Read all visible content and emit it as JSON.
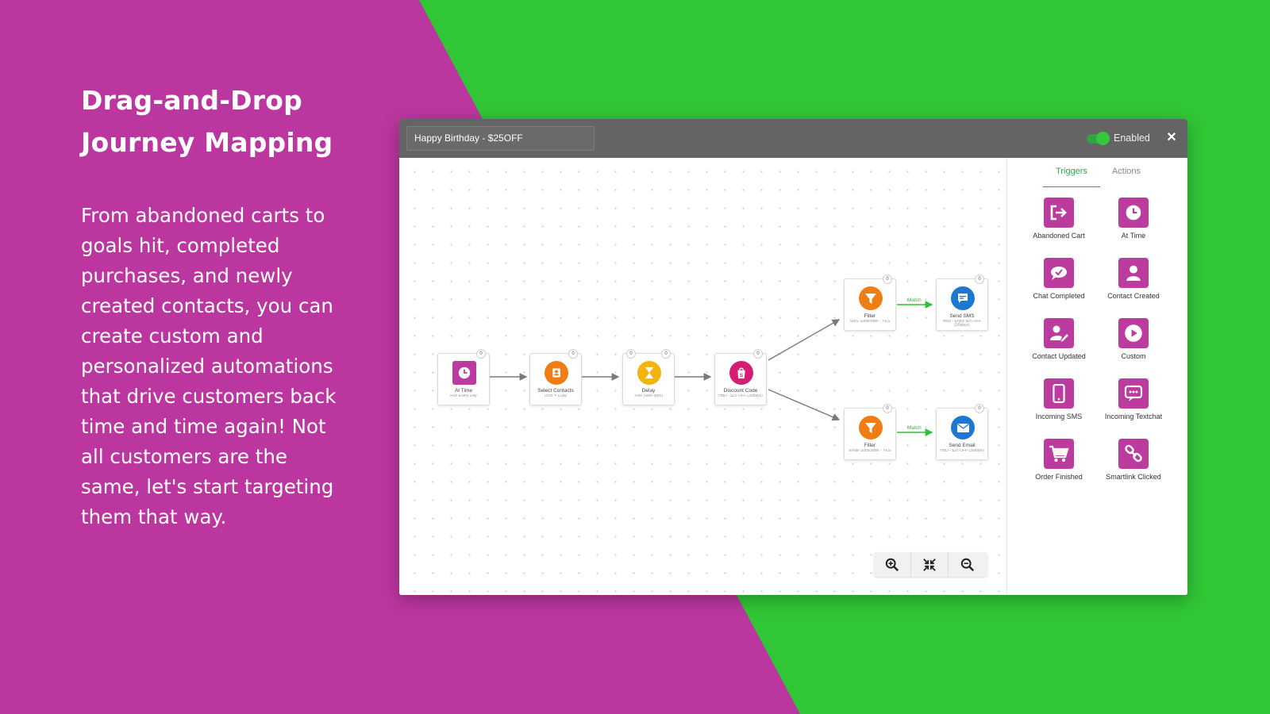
{
  "colors": {
    "magenta_bg": "#bb369f",
    "green_bg": "#30c636",
    "trigger_icon": "#bb3b9f",
    "accent_green": "#2faa47",
    "orange": "#ef7d13",
    "yellow": "#f2b30c",
    "pink": "#d61d73",
    "blue": "#1e78d1"
  },
  "hero": {
    "title_line1": "Drag-and-Drop",
    "title_line2": "Journey Mapping",
    "body": "From abandoned carts to goals hit, completed purchases, and newly created contacts, you can create custom and personalized automations that drive customers back time and time again! Not all customers are the same, let's start targeting them that way."
  },
  "window": {
    "journey_name": "Happy Birthday - $25OFF",
    "status_label": "Enabled",
    "status_enabled": true,
    "close_icon": "close-icon"
  },
  "flow": {
    "nodes": [
      {
        "title": "At Time",
        "subtitle": "Run Every Day",
        "count": "0",
        "icon": "clock-icon"
      },
      {
        "title": "Select Contacts",
        "subtitle": "DOB = 1Day",
        "count": "0",
        "icon": "contacts-icon"
      },
      {
        "title": "Delay",
        "subtitle": "+9hr (9am-9pm)",
        "count": "0",
        "icon": "hourglass-icon"
      },
      {
        "title": "Discount Code",
        "subtitle": "HBD - $25 OFF (30days)",
        "count": "0",
        "icon": "shopify-icon"
      },
      {
        "title": "Filter",
        "subtitle": "SMS Subscriber - YES",
        "count": "0",
        "icon": "filter-icon"
      },
      {
        "title": "Send SMS",
        "subtitle": "HBD - Enjoy $25 OFF (30days)",
        "count": "0",
        "icon": "sms-icon"
      },
      {
        "title": "Filter",
        "subtitle": "Email Subscriber - YES",
        "count": "0",
        "icon": "filter-icon"
      },
      {
        "title": "Send Email",
        "subtitle": "HBD - $25 OFF (30days)",
        "count": "0",
        "icon": "email-icon"
      }
    ],
    "match_label_1": "Match",
    "match_label_2": "Match"
  },
  "panel": {
    "tabs": [
      "Triggers",
      "Actions"
    ],
    "active_tab": "Triggers",
    "triggers": [
      {
        "label": "Abandoned Cart",
        "icon": "exit-icon"
      },
      {
        "label": "At Time",
        "icon": "clock-icon"
      },
      {
        "label": "Chat Completed",
        "icon": "chat-check-icon"
      },
      {
        "label": "Contact Created",
        "icon": "person-icon"
      },
      {
        "label": "Contact Updated",
        "icon": "person-edit-icon"
      },
      {
        "label": "Custom",
        "icon": "play-icon"
      },
      {
        "label": "Incoming SMS",
        "icon": "phone-icon"
      },
      {
        "label": "Incoming Textchat",
        "icon": "chat-dots-icon"
      },
      {
        "label": "Order Finished",
        "icon": "cart-icon"
      },
      {
        "label": "Smartlink Clicked",
        "icon": "link-icon"
      }
    ]
  },
  "zoom_controls": [
    {
      "name": "zoom-in",
      "icon": "zoom-in-icon"
    },
    {
      "name": "fit",
      "icon": "fit-screen-icon"
    },
    {
      "name": "zoom-out",
      "icon": "zoom-out-icon"
    }
  ]
}
